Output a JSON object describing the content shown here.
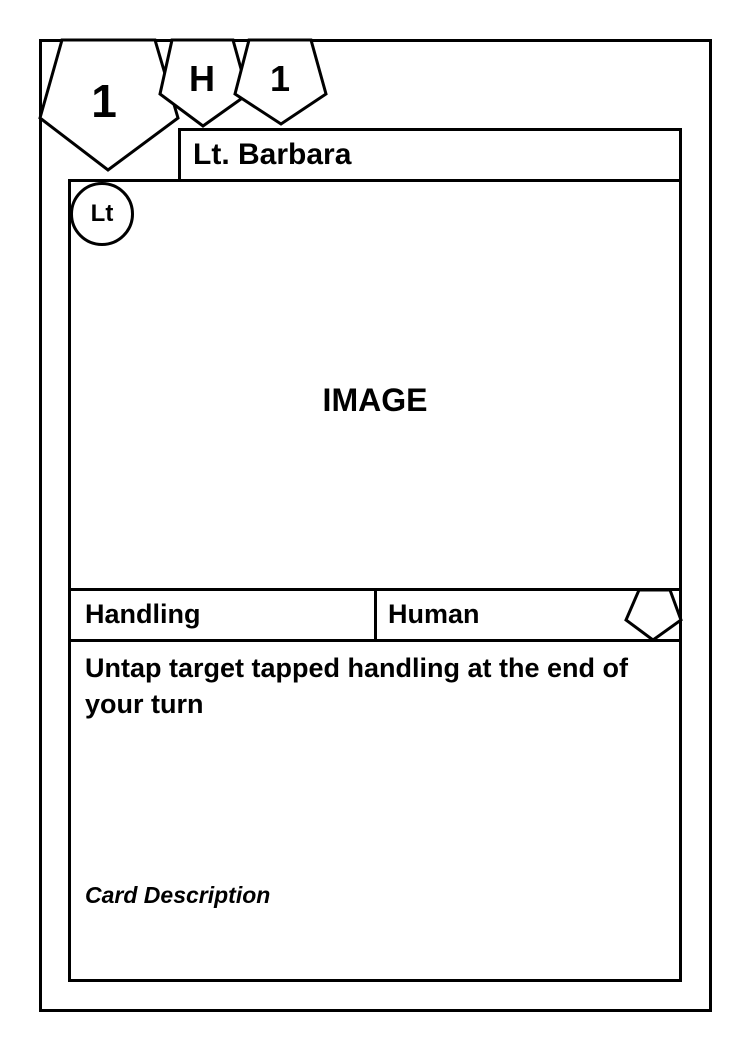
{
  "card": {
    "cost": "1",
    "attribute_left": "H",
    "attribute_right": "1",
    "name": "Lt. Barbara",
    "rank_badge": "Lt",
    "image_placeholder": "IMAGE",
    "type_primary": "Handling",
    "type_secondary": "Human",
    "rules_text": "Untap target tapped handling at the end of your turn",
    "flavor_text": "Card Description"
  },
  "colors": {
    "stroke": "#000000",
    "background": "#ffffff"
  },
  "icons": {
    "cost": "pentagon-icon",
    "attribute_left": "pentagon-icon",
    "attribute_right": "pentagon-icon",
    "type_corner": "pentagon-icon",
    "rank": "circle-icon"
  }
}
